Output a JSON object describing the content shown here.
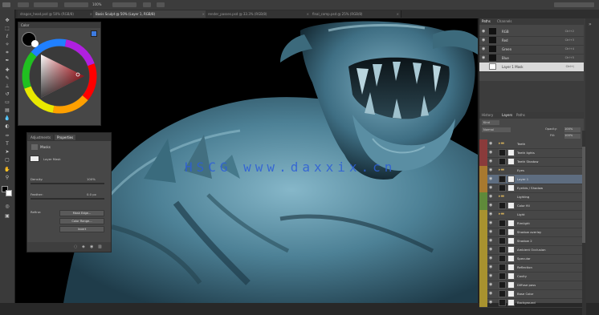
{
  "watermark": "HSCG www.daxxix.cn",
  "options_bar": {
    "zoom_value": "100%"
  },
  "document_tabs": [
    {
      "label": "dragon_head.psd @ 50% (RGB/8)",
      "active": false
    },
    {
      "label": "Basis Sculpt @ 50% (Layer 1, RGB/8)",
      "active": true
    },
    {
      "label": "render_passes.psd @ 33.3% (RGB/8)",
      "active": false
    },
    {
      "label": "final_comp.psd @ 25% (RGB/8)",
      "active": false
    }
  ],
  "colors": {
    "foreground": "#000000",
    "background": "#ffffff",
    "accent": "#3d7be0",
    "selection": "#5e6d80",
    "watermark": "#2d5ed8"
  },
  "color_panel": {
    "title": "Color"
  },
  "properties_panel": {
    "tabs": [
      "Adjustments",
      "Properties"
    ],
    "header": "Masks",
    "mask_label": "Layer Mask",
    "density_label": "Density:",
    "density_value": "100%",
    "feather_label": "Feather:",
    "feather_value": "0.0 px",
    "refine_label": "Refine:",
    "buttons": [
      "Mask Edge...",
      "Color Range...",
      "Invert"
    ]
  },
  "paths_panel": {
    "tabs": [
      "Paths",
      "Channels"
    ],
    "rows": [
      {
        "label": "RGB",
        "shortcut": "Ctrl+2"
      },
      {
        "label": "Red",
        "shortcut": "Ctrl+3"
      },
      {
        "label": "Green",
        "shortcut": "Ctrl+4"
      },
      {
        "label": "Blue",
        "shortcut": "Ctrl+5"
      },
      {
        "label": "Layer 1 Mask",
        "shortcut": "Ctrl+\\"
      }
    ]
  },
  "layers_panel": {
    "tabs": [
      "Layers",
      "Paths",
      "History"
    ],
    "filter_label": "Kind",
    "blend_mode": "Normal",
    "opacity_label": "Opacity:",
    "opacity_value": "100%",
    "fill_label": "Fill:",
    "fill_value": "100%",
    "rows": [
      {
        "name": "Teeth",
        "color": "#8a3b3b",
        "type": "group",
        "selected": false
      },
      {
        "name": "Teeth lights",
        "color": "#8a3b3b",
        "type": "layer",
        "selected": false
      },
      {
        "name": "Teeth Shadow",
        "color": "#8a3b3b",
        "type": "layer",
        "selected": false
      },
      {
        "name": "Eyes",
        "color": "#a8792f",
        "type": "group",
        "selected": false
      },
      {
        "name": "Layer 1",
        "color": "#a8792f",
        "type": "layer",
        "selected": true
      },
      {
        "name": "Eyelids / Shadow",
        "color": "#a8792f",
        "type": "layer",
        "selected": false
      },
      {
        "name": "Lighting",
        "color": "#5f8a3a",
        "type": "group",
        "selected": false
      },
      {
        "name": "Color fill",
        "color": "#5f8a3a",
        "type": "layer",
        "selected": false
      },
      {
        "name": "Light",
        "color": "#a8922f",
        "type": "group",
        "selected": false
      },
      {
        "name": "Rimlight",
        "color": "#a8922f",
        "type": "layer",
        "selected": false
      },
      {
        "name": "Shadow overlay",
        "color": "#a8922f",
        "type": "layer",
        "selected": false
      },
      {
        "name": "Shadow 2",
        "color": "#a8922f",
        "type": "layer",
        "selected": false
      },
      {
        "name": "Ambient Occlusion",
        "color": "#a8922f",
        "type": "layer",
        "selected": false
      },
      {
        "name": "Specular",
        "color": "#a8922f",
        "type": "layer",
        "selected": false
      },
      {
        "name": "Reflection",
        "color": "#a8922f",
        "type": "layer",
        "selected": false
      },
      {
        "name": "Cavity",
        "color": "#a8922f",
        "type": "layer",
        "selected": false
      },
      {
        "name": "Diffuse pass",
        "color": "#a8922f",
        "type": "layer",
        "selected": false
      },
      {
        "name": "Base Color",
        "color": "#a8922f",
        "type": "layer",
        "selected": false
      },
      {
        "name": "Background",
        "color": "#a8922f",
        "type": "layer",
        "selected": false
      }
    ]
  },
  "icons": [
    "move-icon",
    "marquee-icon",
    "lasso-icon",
    "magic-wand-icon",
    "crop-icon",
    "eyedropper-icon",
    "healing-icon",
    "brush-icon",
    "clone-stamp-icon",
    "history-brush-icon",
    "eraser-icon",
    "gradient-icon",
    "blur-icon",
    "dodge-icon",
    "pen-icon",
    "type-icon",
    "path-select-icon",
    "shape-icon",
    "hand-icon",
    "zoom-icon",
    "eye-icon",
    "folder-icon"
  ]
}
